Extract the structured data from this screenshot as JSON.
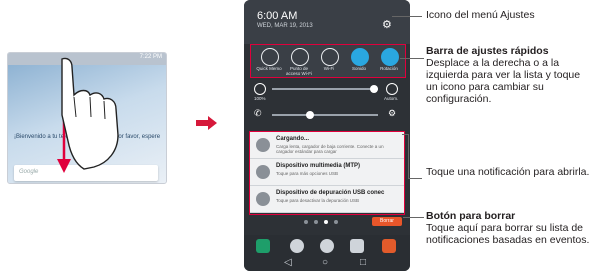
{
  "left_phone": {
    "status_time": "7:22 PM",
    "card_text": "¡Bienvenido a tu teléfono! Iniciando... Por favor, espere",
    "search_placeholder": "Google"
  },
  "right_phone": {
    "time": "6:00 AM",
    "date": "WED, MAR 19, 2013",
    "quick_settings": [
      {
        "label": "Quick Memo",
        "icon": "quick-memo-icon"
      },
      {
        "label": "Punto de acceso Wi-Fi",
        "icon": "hotspot-icon"
      },
      {
        "label": "Wi-Fi",
        "icon": "wifi-icon"
      },
      {
        "label": "Sonido",
        "icon": "sound-icon"
      },
      {
        "label": "Rotación",
        "icon": "rotation-icon"
      }
    ],
    "brightness_pct": "100%",
    "auto_label": "Autom.",
    "notifications": [
      {
        "title": "Cargando...",
        "sub": "Carga lenta, cargador de baja corriente. Conecte a un cargador estándar para cargar"
      },
      {
        "title": "Dispositivo multimedia (MTP)",
        "sub": "Toque para más opciones USB"
      },
      {
        "title": "Dispositivo de depuración USB conec",
        "sub": "Toque para desactivar la depuración USB"
      }
    ],
    "clear_label": "Borrar"
  },
  "callouts": {
    "settings_icon": "Icono del menú Ajustes",
    "quick_bar_title": "Barra de ajustes rápidos",
    "quick_bar_body": "Desplace a la derecha o a la izquierda para ver la lista y toque un icono para cambiar su configuración.",
    "notification_body": "Toque una notificación para abrirla.",
    "clear_title": "Botón para borrar",
    "clear_body": "Toque aquí para borrar su lista de notificaciones basadas en eventos."
  },
  "colors": {
    "accent_red": "#e0003c",
    "arrow_red": "#d6183a",
    "quick_active": "#2aa7e0"
  }
}
